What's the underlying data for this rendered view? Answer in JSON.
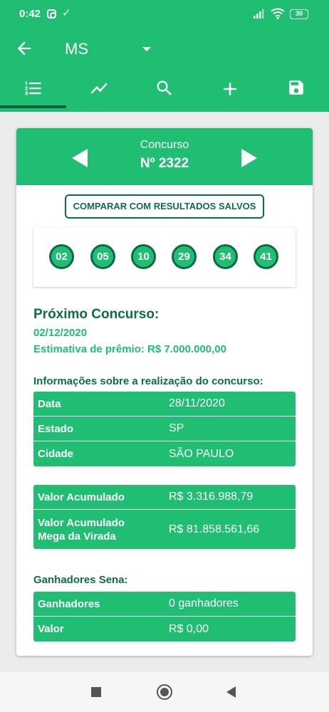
{
  "status_bar": {
    "time": "0:42",
    "battery": "30",
    "icons": [
      "instagram-icon",
      "download-done-icon",
      "signal-icon",
      "wifi-icon",
      "battery-icon"
    ]
  },
  "app_bar": {
    "title": "MS",
    "icons": [
      "back-arrow-icon",
      "dropdown-arrow-icon"
    ],
    "tabs": [
      {
        "name": "results-list",
        "icon": "numbered-list-icon",
        "selected": true
      },
      {
        "name": "statistics",
        "icon": "trending-chart-icon",
        "selected": false
      },
      {
        "name": "search",
        "icon": "search-icon",
        "selected": false
      },
      {
        "name": "add",
        "icon": "plus-icon",
        "selected": false
      },
      {
        "name": "save",
        "icon": "save-icon",
        "selected": false
      }
    ]
  },
  "contest": {
    "label": "Concurso",
    "number": "Nº 2322"
  },
  "compare_button": "COMPARAR COM RESULTADOS SALVOS",
  "drawn_numbers": [
    "02",
    "05",
    "10",
    "29",
    "34",
    "41"
  ],
  "next_contest": {
    "title": "Próximo Concurso:",
    "date": "02/12/2020",
    "estimate": "Estimativa de prêmio: R$  7.000.000,00"
  },
  "realization": {
    "title": "Informações sobre a realização do concurso:",
    "rows": [
      {
        "key": "Data",
        "value": "28/11/2020"
      },
      {
        "key": "Estado",
        "value": "SP"
      },
      {
        "key": "Cidade",
        "value": "SÃO PAULO"
      }
    ]
  },
  "accumulated": {
    "rows": [
      {
        "key": "Valor Acumulado",
        "value": "R$  3.316.988,79"
      },
      {
        "key": "Valor Acumulado\nMega da Virada",
        "value": "R$  81.858.561,66"
      }
    ]
  },
  "winners": {
    "title": "Ganhadores Sena:",
    "rows": [
      {
        "key": "Ganhadores",
        "value": "0 ganhadores"
      },
      {
        "key": "Valor",
        "value": "R$  0,00"
      }
    ]
  },
  "colors": {
    "primary": "#1fbe72",
    "dark": "#0c6e46",
    "tab_indicator": "#08603a"
  }
}
